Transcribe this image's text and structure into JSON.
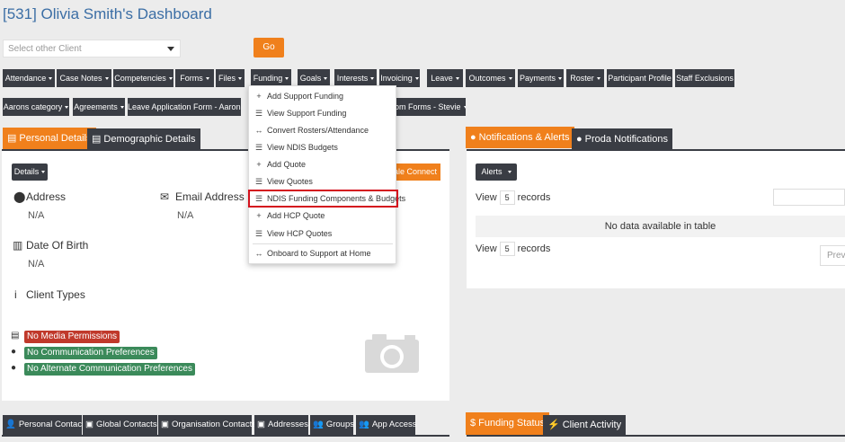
{
  "page": {
    "title": "[531] Olivia Smith's Dashboard"
  },
  "client_select": {
    "placeholder": "Select other Client",
    "go_label": "Go"
  },
  "nav1": [
    {
      "label": "Attendance",
      "caret": true
    },
    {
      "label": "Case Notes",
      "caret": true
    },
    {
      "label": "Competencies",
      "caret": true
    },
    {
      "label": "Forms",
      "caret": true
    },
    {
      "label": "Files",
      "caret": true
    },
    {
      "label": "Funding",
      "caret": true
    },
    {
      "label": "Goals",
      "caret": true
    },
    {
      "label": "Interests",
      "caret": true
    },
    {
      "label": "Invoicing",
      "caret": true
    },
    {
      "label": "Leave",
      "caret": true
    },
    {
      "label": "Outcomes",
      "caret": true
    },
    {
      "label": "Payments",
      "caret": true
    },
    {
      "label": "Roster",
      "caret": true
    },
    {
      "label": "Participant Profile",
      "caret": false
    },
    {
      "label": "Staff Exclusions",
      "caret": false
    }
  ],
  "nav2": [
    {
      "label": "Aarons category",
      "caret": true
    },
    {
      "label": "Agreements",
      "caret": true
    },
    {
      "label": "Leave Application Form - Aaron",
      "caret": true
    },
    {
      "label": "stom Forms - Stevie",
      "caret": true
    }
  ],
  "funding_menu": [
    {
      "icon": "plus-icon",
      "glyph": "+",
      "label": "Add Support Funding"
    },
    {
      "icon": "list-icon",
      "glyph": "☰",
      "label": "View Support Funding"
    },
    {
      "icon": "arrows-icon",
      "glyph": "↔",
      "label": "Convert Rosters/Attendance"
    },
    {
      "icon": "list-icon",
      "glyph": "☰",
      "label": "View NDIS Budgets"
    },
    {
      "icon": "plus-icon",
      "glyph": "+",
      "label": "Add Quote"
    },
    {
      "icon": "list-icon",
      "glyph": "☰",
      "label": "View Quotes"
    },
    {
      "icon": "list-icon",
      "glyph": "☰",
      "label": "NDIS Funding Components & Budgets",
      "highlighted": true
    },
    {
      "icon": "plus-icon",
      "glyph": "+",
      "label": "Add HCP Quote"
    },
    {
      "icon": "list-icon",
      "glyph": "☰",
      "label": "View HCP Quotes"
    },
    {
      "icon": "arrows-icon",
      "glyph": "↔",
      "label": "Onboard to Support at Home"
    }
  ],
  "left_panel": {
    "tab_personal": "Personal Details",
    "tab_demographic": "Demographic Details",
    "details_btn": "Details",
    "connect_btn": "ale Connect",
    "address_label": "Address",
    "address_value": "N/A",
    "email_label": "Email Address",
    "email_value": "N/A",
    "dob_label": "Date Of Birth",
    "dob_value": "N/A",
    "client_types_label": "Client Types",
    "badges": [
      {
        "label": "No Media Permissions",
        "color": "#c0392b"
      },
      {
        "label": "No Communication Preferences",
        "color": "#3b8a5a"
      },
      {
        "label": "No Alternate Communication Preferences",
        "color": "#3b8a5a"
      }
    ]
  },
  "right_panel": {
    "tab_notifications": "Notifications & Alerts",
    "tab_proda": "Proda Notifications",
    "alerts_btn": "Alerts",
    "view_label": "View",
    "records_label": "records",
    "records_count": "5",
    "empty_message": "No data available in table",
    "prev_label": "Prev"
  },
  "bottom_left_tabs": [
    {
      "icon": "person-icon",
      "glyph": "👤",
      "label": "Personal Contacts"
    },
    {
      "icon": "address-book-icon",
      "glyph": "▣",
      "label": "Global Contacts"
    },
    {
      "icon": "address-book-icon",
      "glyph": "▣",
      "label": "Organisation Contacts"
    },
    {
      "icon": "address-book-icon",
      "glyph": "▣",
      "label": "Addresses"
    },
    {
      "icon": "users-icon",
      "glyph": "👥",
      "label": "Groups"
    },
    {
      "icon": "users-icon",
      "glyph": "👥",
      "label": "App Access"
    }
  ],
  "bottom_right_tabs": {
    "funding_status": "Funding Status",
    "client_activity": "Client Activity"
  },
  "colors": {
    "accent": "#f0801c",
    "dark": "#3a3d44",
    "title_blue": "#3b6ea5",
    "highlight_red": "#d4121e"
  }
}
